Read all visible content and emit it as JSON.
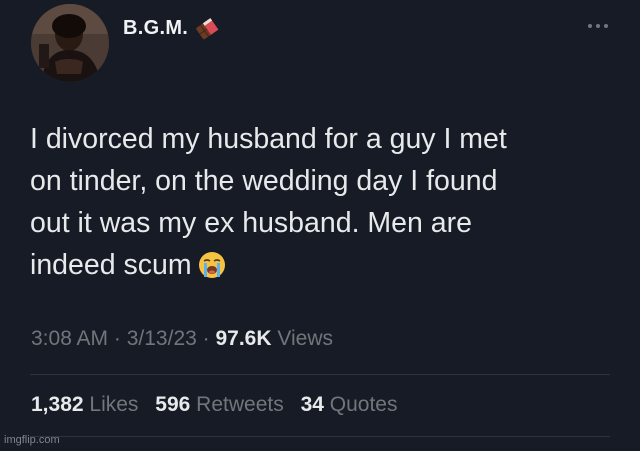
{
  "user": {
    "display_name": "B.G.M."
  },
  "tweet": {
    "lines": [
      "I divorced my husband for a guy I met",
      "on tinder, on the wedding day I found",
      "out it was my ex husband. Men are",
      "indeed scum"
    ],
    "emoji_icon": "loudly-crying-face-icon"
  },
  "meta": {
    "time": "3:08 AM",
    "separator": " · ",
    "date": "3/13/23",
    "views_count": "97.6K",
    "views_label": "Views"
  },
  "stats": {
    "likes_count": "1,382",
    "likes_label": "Likes",
    "retweets_count": "596",
    "retweets_label": "Retweets",
    "quotes_count": "34",
    "quotes_label": "Quotes"
  },
  "watermark": "imgflip.com",
  "colors": {
    "background": "#161b26",
    "text_primary": "#e7e9ea",
    "text_secondary": "#71767b",
    "divider": "#2f3336"
  }
}
